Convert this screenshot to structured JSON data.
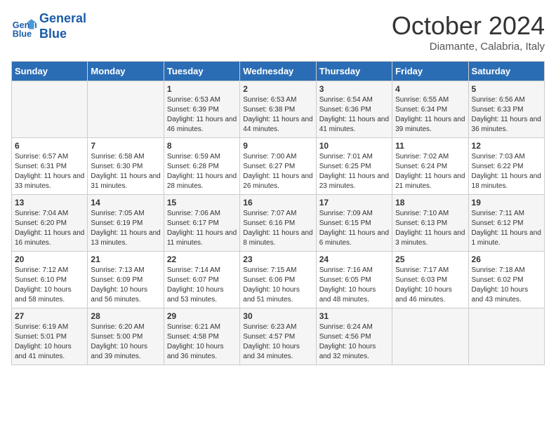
{
  "header": {
    "logo_line1": "General",
    "logo_line2": "Blue",
    "month": "October 2024",
    "location": "Diamante, Calabria, Italy"
  },
  "days_of_week": [
    "Sunday",
    "Monday",
    "Tuesday",
    "Wednesday",
    "Thursday",
    "Friday",
    "Saturday"
  ],
  "weeks": [
    [
      {
        "day": "",
        "info": ""
      },
      {
        "day": "",
        "info": ""
      },
      {
        "day": "1",
        "info": "Sunrise: 6:53 AM\nSunset: 6:39 PM\nDaylight: 11 hours and 46 minutes."
      },
      {
        "day": "2",
        "info": "Sunrise: 6:53 AM\nSunset: 6:38 PM\nDaylight: 11 hours and 44 minutes."
      },
      {
        "day": "3",
        "info": "Sunrise: 6:54 AM\nSunset: 6:36 PM\nDaylight: 11 hours and 41 minutes."
      },
      {
        "day": "4",
        "info": "Sunrise: 6:55 AM\nSunset: 6:34 PM\nDaylight: 11 hours and 39 minutes."
      },
      {
        "day": "5",
        "info": "Sunrise: 6:56 AM\nSunset: 6:33 PM\nDaylight: 11 hours and 36 minutes."
      }
    ],
    [
      {
        "day": "6",
        "info": "Sunrise: 6:57 AM\nSunset: 6:31 PM\nDaylight: 11 hours and 33 minutes."
      },
      {
        "day": "7",
        "info": "Sunrise: 6:58 AM\nSunset: 6:30 PM\nDaylight: 11 hours and 31 minutes."
      },
      {
        "day": "8",
        "info": "Sunrise: 6:59 AM\nSunset: 6:28 PM\nDaylight: 11 hours and 28 minutes."
      },
      {
        "day": "9",
        "info": "Sunrise: 7:00 AM\nSunset: 6:27 PM\nDaylight: 11 hours and 26 minutes."
      },
      {
        "day": "10",
        "info": "Sunrise: 7:01 AM\nSunset: 6:25 PM\nDaylight: 11 hours and 23 minutes."
      },
      {
        "day": "11",
        "info": "Sunrise: 7:02 AM\nSunset: 6:24 PM\nDaylight: 11 hours and 21 minutes."
      },
      {
        "day": "12",
        "info": "Sunrise: 7:03 AM\nSunset: 6:22 PM\nDaylight: 11 hours and 18 minutes."
      }
    ],
    [
      {
        "day": "13",
        "info": "Sunrise: 7:04 AM\nSunset: 6:20 PM\nDaylight: 11 hours and 16 minutes."
      },
      {
        "day": "14",
        "info": "Sunrise: 7:05 AM\nSunset: 6:19 PM\nDaylight: 11 hours and 13 minutes."
      },
      {
        "day": "15",
        "info": "Sunrise: 7:06 AM\nSunset: 6:17 PM\nDaylight: 11 hours and 11 minutes."
      },
      {
        "day": "16",
        "info": "Sunrise: 7:07 AM\nSunset: 6:16 PM\nDaylight: 11 hours and 8 minutes."
      },
      {
        "day": "17",
        "info": "Sunrise: 7:09 AM\nSunset: 6:15 PM\nDaylight: 11 hours and 6 minutes."
      },
      {
        "day": "18",
        "info": "Sunrise: 7:10 AM\nSunset: 6:13 PM\nDaylight: 11 hours and 3 minutes."
      },
      {
        "day": "19",
        "info": "Sunrise: 7:11 AM\nSunset: 6:12 PM\nDaylight: 11 hours and 1 minute."
      }
    ],
    [
      {
        "day": "20",
        "info": "Sunrise: 7:12 AM\nSunset: 6:10 PM\nDaylight: 10 hours and 58 minutes."
      },
      {
        "day": "21",
        "info": "Sunrise: 7:13 AM\nSunset: 6:09 PM\nDaylight: 10 hours and 56 minutes."
      },
      {
        "day": "22",
        "info": "Sunrise: 7:14 AM\nSunset: 6:07 PM\nDaylight: 10 hours and 53 minutes."
      },
      {
        "day": "23",
        "info": "Sunrise: 7:15 AM\nSunset: 6:06 PM\nDaylight: 10 hours and 51 minutes."
      },
      {
        "day": "24",
        "info": "Sunrise: 7:16 AM\nSunset: 6:05 PM\nDaylight: 10 hours and 48 minutes."
      },
      {
        "day": "25",
        "info": "Sunrise: 7:17 AM\nSunset: 6:03 PM\nDaylight: 10 hours and 46 minutes."
      },
      {
        "day": "26",
        "info": "Sunrise: 7:18 AM\nSunset: 6:02 PM\nDaylight: 10 hours and 43 minutes."
      }
    ],
    [
      {
        "day": "27",
        "info": "Sunrise: 6:19 AM\nSunset: 5:01 PM\nDaylight: 10 hours and 41 minutes."
      },
      {
        "day": "28",
        "info": "Sunrise: 6:20 AM\nSunset: 5:00 PM\nDaylight: 10 hours and 39 minutes."
      },
      {
        "day": "29",
        "info": "Sunrise: 6:21 AM\nSunset: 4:58 PM\nDaylight: 10 hours and 36 minutes."
      },
      {
        "day": "30",
        "info": "Sunrise: 6:23 AM\nSunset: 4:57 PM\nDaylight: 10 hours and 34 minutes."
      },
      {
        "day": "31",
        "info": "Sunrise: 6:24 AM\nSunset: 4:56 PM\nDaylight: 10 hours and 32 minutes."
      },
      {
        "day": "",
        "info": ""
      },
      {
        "day": "",
        "info": ""
      }
    ]
  ]
}
